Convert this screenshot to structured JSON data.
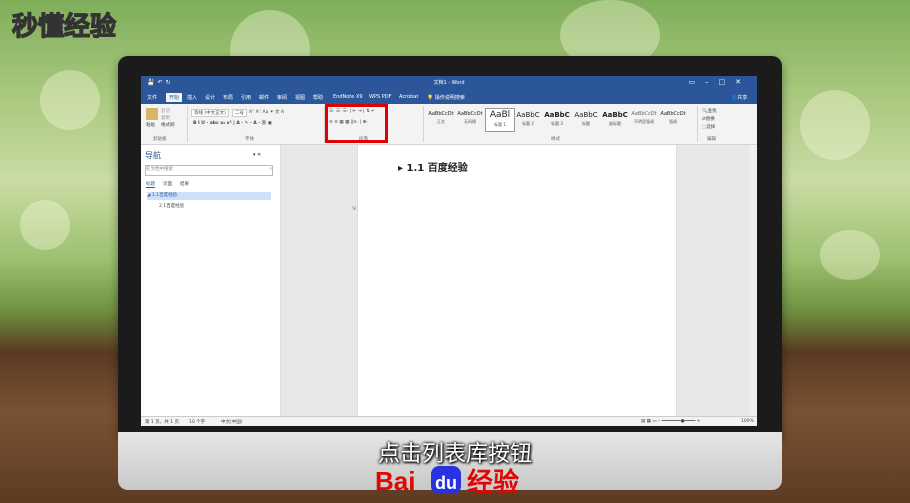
{
  "watermark": {
    "text": "秒懂经验"
  },
  "word": {
    "window_title": "文档1 - Word",
    "menu": [
      "文件",
      "开始",
      "插入",
      "设计",
      "布局",
      "引用",
      "邮件",
      "审阅",
      "视图",
      "帮助",
      "EndNote X9",
      "WPS PDF",
      "Acrobat"
    ],
    "tell_me": "操作说明搜索",
    "share": "共享",
    "clipboard": {
      "paste": "粘贴",
      "cut": "剪切",
      "copy": "复制",
      "format_painter": "格式刷",
      "label": "剪贴板"
    },
    "font": {
      "name": "等线 (中文正文)",
      "size": "二号",
      "label": "字体"
    },
    "paragraph": {
      "label": "段落"
    },
    "styles": {
      "label": "样式",
      "items": [
        {
          "sample": "AaBbCcDt",
          "name": "正文"
        },
        {
          "sample": "AaBbCcDt",
          "name": "无间隔"
        },
        {
          "sample": "AaBl",
          "name": "标题 1"
        },
        {
          "sample": "AaBbC",
          "name": "标题 2"
        },
        {
          "sample": "AaBbC",
          "name": "标题 3"
        },
        {
          "sample": "AaBbC",
          "name": "标题"
        },
        {
          "sample": "AaBbC",
          "name": "副标题"
        },
        {
          "sample": "AaBbCcDt",
          "name": "不明显强调"
        },
        {
          "sample": "AaBbCcDt",
          "name": "强调"
        }
      ]
    },
    "editing": {
      "find": "查找",
      "replace": "替换",
      "select": "选择",
      "label": "编辑"
    },
    "nav": {
      "title": "导航",
      "search_placeholder": "在文档中搜索",
      "tabs": [
        "标题",
        "页面",
        "结果"
      ],
      "items": [
        "1.1百度经验",
        "2.1百度经验"
      ]
    },
    "document": {
      "heading": "1.1 百度经验"
    },
    "status": {
      "page": "第 1 页，共 1 页",
      "words": "10 个字",
      "lang": "中文(中国)",
      "zoom": "100%"
    }
  },
  "caption": "点击列表库按钮",
  "logo": {
    "bai": "Bai",
    "du": "du",
    "jingyan": "经验"
  }
}
